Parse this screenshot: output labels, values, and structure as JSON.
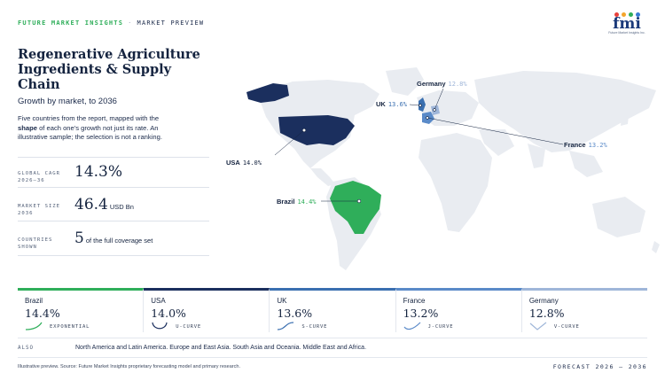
{
  "header": {
    "brand": "FUTURE MARKET INSIGHTS",
    "separator": "·",
    "section": "MARKET PREVIEW"
  },
  "logo": {
    "word": "fmi",
    "sub": "Future Market Insights Inc.",
    "dot_colors": [
      "#e8403a",
      "#f4a52c",
      "#2fae5a",
      "#3a7bd5"
    ]
  },
  "title": "Regenerative Agriculture Ingredients & Supply Chain",
  "subtitle": "Growth by market, to 2036",
  "description": {
    "pre": "Five countries from the report, mapped with the ",
    "bold": "shape",
    "post": " of each one's growth not just its rate. An illustrative sample; the selection is not a ranking."
  },
  "stats": {
    "cagr": {
      "label": "GLOBAL CAGR 2026–36",
      "value": "14.3%"
    },
    "size": {
      "label": "MARKET SIZE 2036",
      "value": "46.4",
      "unit": "USD Bn"
    },
    "countries": {
      "label": "COUNTRIES SHOWN",
      "value": "5",
      "note": "of the full coverage set"
    }
  },
  "map_labels": [
    {
      "country": "Germany",
      "rate": "12.8%",
      "color": "#9fb6d9"
    },
    {
      "country": "UK",
      "rate": "13.6%",
      "color": "#3a6fb0"
    },
    {
      "country": "France",
      "rate": "13.2%",
      "color": "#5a8ac8"
    },
    {
      "country": "USA",
      "rate": "14.0%",
      "color": "#14233f"
    },
    {
      "country": "Brazil",
      "rate": "14.4%",
      "color": "#2fae5a"
    }
  ],
  "countries": [
    {
      "name": "Brazil",
      "rate": "14.4%",
      "shape": "EXPONENTIAL",
      "color": "#2fae5a",
      "icon": "exponential-curve-icon"
    },
    {
      "name": "USA",
      "rate": "14.0%",
      "shape": "U-CURVE",
      "color": "#1b2f5e",
      "icon": "u-curve-icon"
    },
    {
      "name": "UK",
      "rate": "13.6%",
      "shape": "S-CURVE",
      "color": "#3a6fb0",
      "icon": "s-curve-icon"
    },
    {
      "name": "France",
      "rate": "13.2%",
      "shape": "J-CURVE",
      "color": "#5a8ac8",
      "icon": "j-curve-icon"
    },
    {
      "name": "Germany",
      "rate": "12.8%",
      "shape": "V-CURVE",
      "color": "#9fb6d9",
      "icon": "v-curve-icon"
    }
  ],
  "also": {
    "label": "ALSO",
    "text": "North America and Latin America. Europe and East Asia. South Asia and Oceania. Middle East and Africa."
  },
  "footer": {
    "source": "Illustrative preview. Source: Future Market Insights proprietary forecasting model and primary research.",
    "forecast": "FORECAST 2026 – 2036"
  }
}
